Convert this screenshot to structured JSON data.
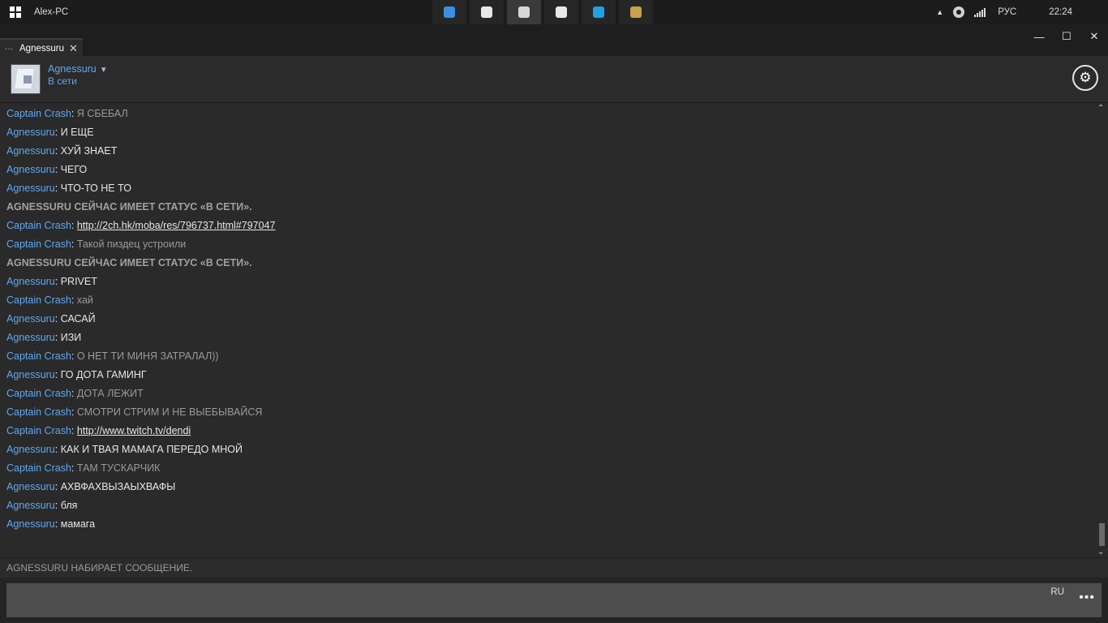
{
  "taskbar": {
    "pc_name": "Alex-PC",
    "apps": [
      {
        "icon": "messenger-app-icon",
        "color": "#3b8fe0",
        "active": false
      },
      {
        "icon": "file-explorer-icon",
        "color": "#e8e8e8",
        "active": false
      },
      {
        "icon": "grenade-app-icon",
        "color": "#d8d8d8",
        "active": true
      },
      {
        "icon": "chrome-icon",
        "color": "#e8e8e8",
        "active": false
      },
      {
        "icon": "skype-icon",
        "color": "#1fa1e3",
        "active": false
      },
      {
        "icon": "league-client-icon",
        "color": "#c8a24a",
        "active": false
      }
    ],
    "lang": "РУС",
    "clock": "22:24"
  },
  "window": {
    "tab_title": "Agnessuru",
    "tab_dots": "···",
    "close_glyph": "✕",
    "minimize_glyph": "—",
    "maximize_glyph": "☐",
    "win_close_glyph": "✕"
  },
  "contact": {
    "name": "Agnessuru",
    "status": "В сети"
  },
  "messages": [
    {
      "type": "msg",
      "nick": "Captain Crash",
      "from": "other",
      "text": "Я СБЕБАЛ"
    },
    {
      "type": "msg",
      "nick": "Agnessuru",
      "from": "self",
      "text": "И ЕЩЕ"
    },
    {
      "type": "msg",
      "nick": "Agnessuru",
      "from": "self",
      "text": "ХУЙ ЗНАЕТ"
    },
    {
      "type": "msg",
      "nick": "Agnessuru",
      "from": "self",
      "text": "ЧЕГО"
    },
    {
      "type": "msg",
      "nick": "Agnessuru",
      "from": "self",
      "text": "ЧТО-ТО НЕ ТО"
    },
    {
      "type": "system",
      "text": "AGNESSURU СЕЙЧАС ИМЕЕТ СТАТУС «В СЕТИ»."
    },
    {
      "type": "msg",
      "nick": "Captain Crash",
      "from": "link",
      "text": "http://2ch.hk/moba/res/796737.html#797047"
    },
    {
      "type": "msg",
      "nick": "Captain Crash",
      "from": "other",
      "text": "Такой пиздец устроили"
    },
    {
      "type": "system",
      "text": "AGNESSURU СЕЙЧАС ИМЕЕТ СТАТУС «В СЕТИ»."
    },
    {
      "type": "msg",
      "nick": "Agnessuru",
      "from": "self",
      "text": "PRIVET"
    },
    {
      "type": "msg",
      "nick": "Captain Crash",
      "from": "other",
      "text": "хай"
    },
    {
      "type": "msg",
      "nick": "Agnessuru",
      "from": "self",
      "text": "САСАЙ"
    },
    {
      "type": "msg",
      "nick": "Agnessuru",
      "from": "self",
      "text": "ИЗИ"
    },
    {
      "type": "msg",
      "nick": "Captain Crash",
      "from": "other",
      "text": "О НЕТ ТИ МИНЯ ЗАТРАЛАЛ))"
    },
    {
      "type": "msg",
      "nick": "Agnessuru",
      "from": "self",
      "text": "ГО ДОТА ГАМИНГ"
    },
    {
      "type": "msg",
      "nick": "Captain Crash",
      "from": "other",
      "text": "ДОТА ЛЕЖИТ"
    },
    {
      "type": "msg",
      "nick": "Captain Crash",
      "from": "other",
      "text": "СМОТРИ СТРИМ И НЕ ВЫЕБЫВАЙСЯ"
    },
    {
      "type": "msg",
      "nick": "Captain Crash",
      "from": "link",
      "text": "http://www.twitch.tv/dendi"
    },
    {
      "type": "msg",
      "nick": "Agnessuru",
      "from": "self",
      "text": "КАК И ТВАЯ МАМАГА ПЕРЕДО МНОЙ"
    },
    {
      "type": "msg",
      "nick": "Captain Crash",
      "from": "other",
      "text": "ТАМ ТУСКАРЧИК"
    },
    {
      "type": "msg",
      "nick": "Agnessuru",
      "from": "self",
      "text": "АХВФАХВЫЗАЫХВАФЫ"
    },
    {
      "type": "msg",
      "nick": "Agnessuru",
      "from": "self",
      "text": "бля"
    },
    {
      "type": "msg",
      "nick": "Agnessuru",
      "from": "self",
      "text": "мамага"
    }
  ],
  "typing_indicator": "AGNESSURU НАБИРАЕТ СООБЩЕНИЕ.",
  "composer": {
    "value": "",
    "lang": "RU",
    "more_glyph": "•••"
  },
  "colors": {
    "accent": "#5fa7f0",
    "background": "#2a2a2a",
    "other_text": "#9a9a9a",
    "self_text": "#e6e6e6"
  }
}
